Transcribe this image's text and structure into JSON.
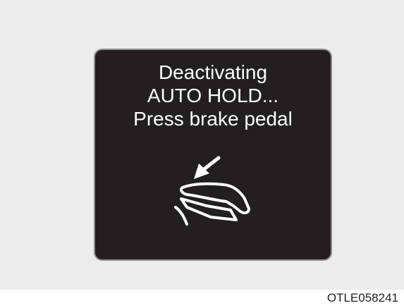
{
  "message": {
    "line1": "Deactivating",
    "line2": "AUTO HOLD...",
    "line3": "Press brake pedal"
  },
  "icon": "brake-pedal-press-icon",
  "figure_code": "OTLE058241",
  "colors": {
    "screen_bg": "#231f20",
    "text": "#ffffff",
    "page_bg": "#ececec"
  }
}
